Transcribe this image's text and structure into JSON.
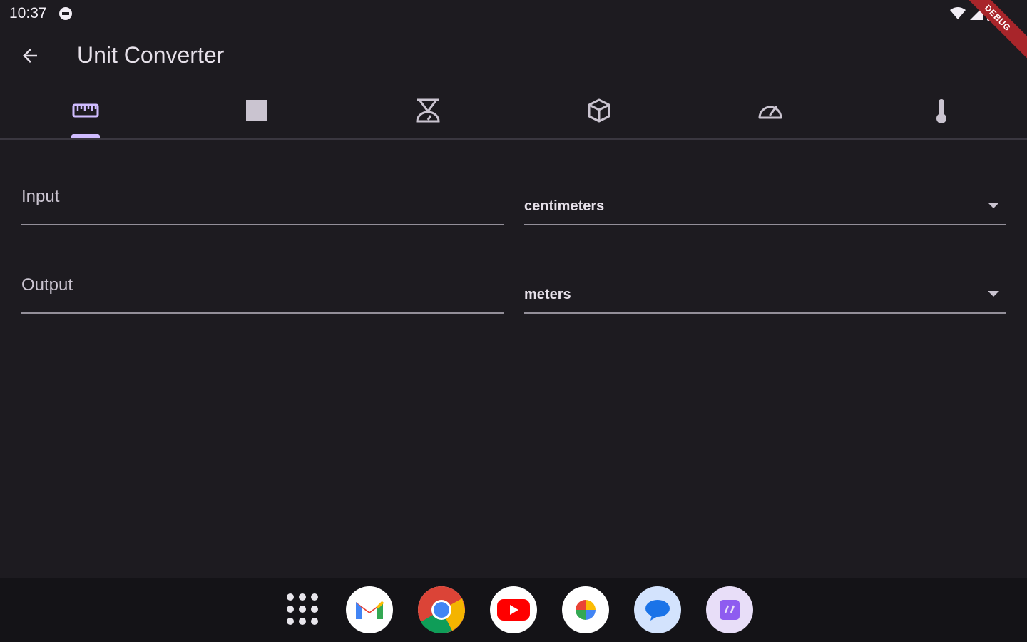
{
  "status": {
    "time": "10:37",
    "debug": "DEBUG"
  },
  "appbar": {
    "title": "Unit Converter"
  },
  "tabs": [
    {
      "icon": "ruler-icon",
      "selected": true
    },
    {
      "icon": "square-area-icon",
      "selected": false
    },
    {
      "icon": "weight-scale-icon",
      "selected": false
    },
    {
      "icon": "cube-volume-icon",
      "selected": false
    },
    {
      "icon": "speedometer-icon",
      "selected": false
    },
    {
      "icon": "thermometer-icon",
      "selected": false
    }
  ],
  "form": {
    "input_label": "Input",
    "input_unit": "centimeters",
    "output_label": "Output",
    "output_unit": "meters"
  },
  "colors": {
    "background": "#1d1b20",
    "accent": "#d0bcff",
    "text": "#e6e0e9"
  },
  "dock": {
    "apps": [
      "all-apps-icon",
      "gmail-icon",
      "chrome-icon",
      "youtube-icon",
      "photos-icon",
      "messages-icon",
      "extra-app-icon"
    ]
  }
}
